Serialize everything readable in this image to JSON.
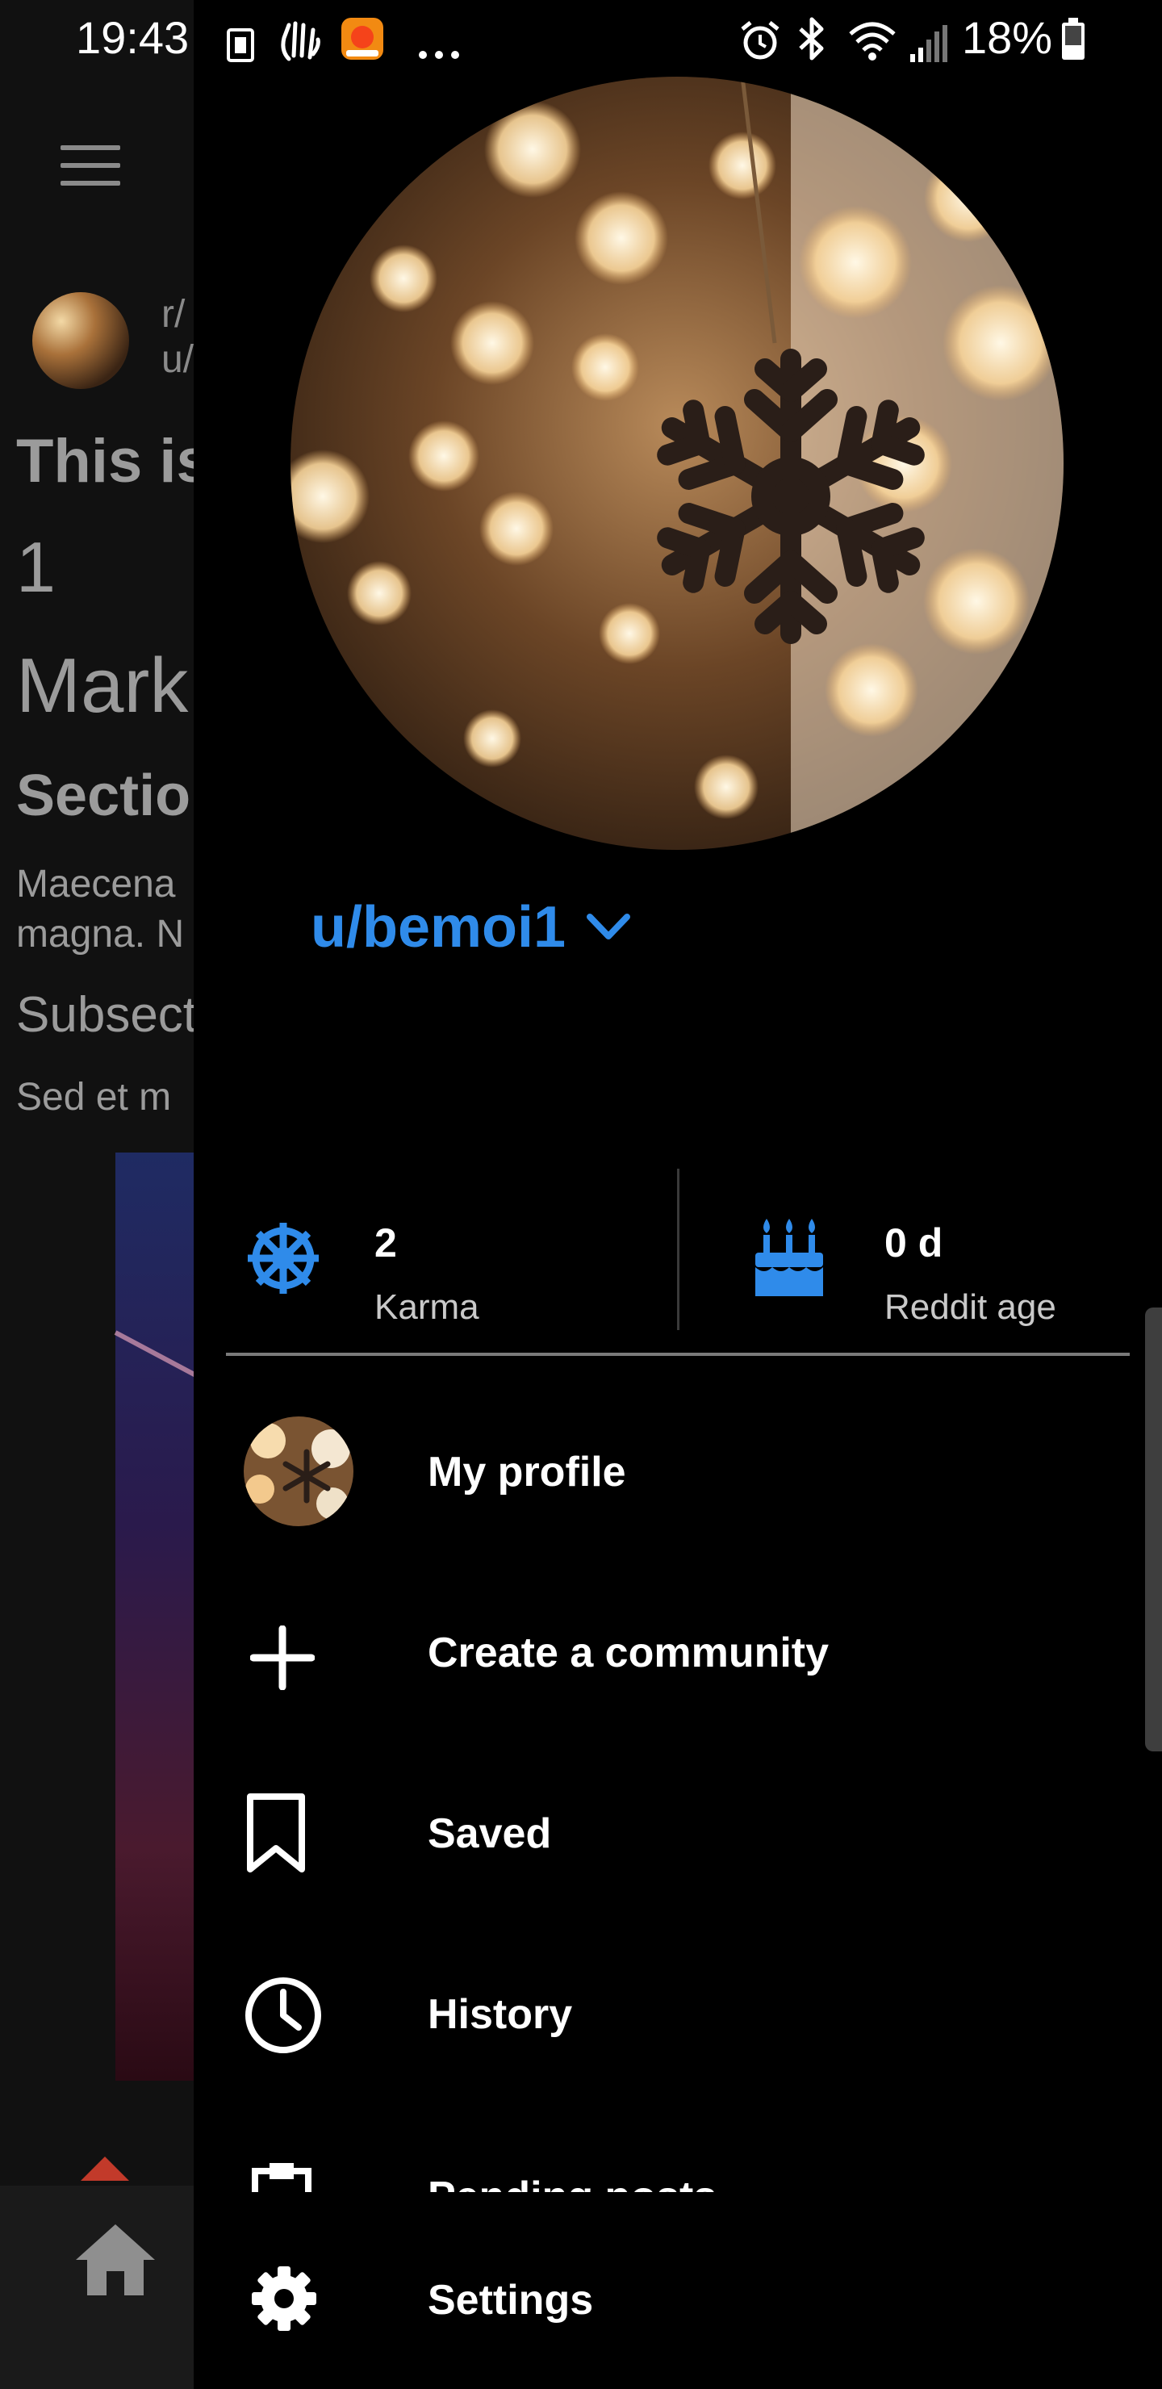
{
  "status_bar": {
    "time": "19:43",
    "battery_percent": "18%",
    "icons": [
      "sim-card-icon",
      "wave-hand-icon",
      "app-notification-icon",
      "more-dots-icon",
      "alarm-icon",
      "bluetooth-icon",
      "wifi-icon",
      "signal-icon",
      "battery-icon"
    ]
  },
  "background_app": {
    "subreddit_prefix": "r/",
    "user_prefix": "u/",
    "post_title_partial": "This is",
    "line_1": "1",
    "heading_partial": "Mark",
    "section_partial": "Sectio",
    "paragraph_line_1": "Maecena",
    "paragraph_line_2": "magna. N",
    "subsection_partial": "Subsect",
    "paragraph2_partial": "Sed et m"
  },
  "drawer": {
    "username": "u/bemoi1",
    "stats": {
      "karma_value": "2",
      "karma_label": "Karma",
      "age_value": "0 d",
      "age_label": "Reddit age"
    },
    "menu": [
      {
        "label": "My profile",
        "icon": "avatar-icon"
      },
      {
        "label": "Create a community",
        "icon": "plus-icon"
      },
      {
        "label": "Saved",
        "icon": "bookmark-icon"
      },
      {
        "label": "History",
        "icon": "clock-icon"
      },
      {
        "label": "Pending posts",
        "icon": "clipboard-icon"
      },
      {
        "label": "Settings",
        "icon": "gear-icon"
      }
    ]
  },
  "colors": {
    "accent": "#2f8bea",
    "drawer_background": "#000000",
    "text_primary": "#ffffff",
    "text_secondary": "#c9c9c9"
  }
}
